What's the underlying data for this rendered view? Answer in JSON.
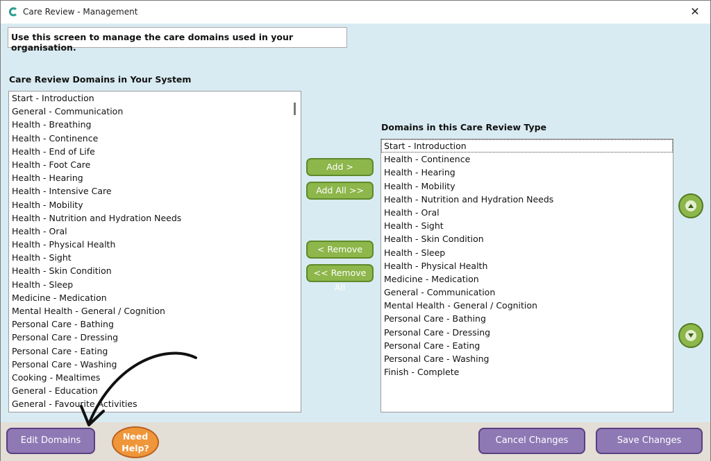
{
  "window": {
    "title": "Care Review - Management",
    "close_symbol": "✕"
  },
  "info_text": "Use this screen to manage the care domains used in your organisation.",
  "left_panel": {
    "label": "Care Review Domains in Your System",
    "items": [
      "Start - Introduction",
      "General - Communication",
      "Health - Breathing",
      "Health - Continence",
      "Health - End of Life",
      "Health - Foot Care",
      "Health - Hearing",
      "Health - Intensive Care",
      "Health - Mobility",
      "Health - Nutrition and Hydration Needs",
      "Health - Oral",
      "Health - Physical Health",
      "Health - Sight",
      "Health - Skin Condition",
      "Health - Sleep",
      "Medicine - Medication",
      "Mental Health - General / Cognition",
      "Personal Care - Bathing",
      "Personal Care - Dressing",
      "Personal Care - Eating",
      "Personal Care - Washing",
      "Cooking - Mealtimes",
      "General - Education",
      "General - Favourite Activities"
    ]
  },
  "right_panel": {
    "label": "Domains in this Care Review Type",
    "items": [
      "Start - Introduction",
      "Health - Continence",
      "Health - Hearing",
      "Health - Mobility",
      "Health - Nutrition and Hydration Needs",
      "Health - Oral",
      "Health - Sight",
      "Health - Skin Condition",
      "Health - Sleep",
      "Health - Physical Health",
      "Medicine - Medication",
      "General - Communication",
      "Mental Health - General / Cognition",
      "Personal Care - Bathing",
      "Personal Care - Dressing",
      "Personal Care - Eating",
      "Personal Care - Washing",
      "Finish - Complete"
    ]
  },
  "transfer_buttons": {
    "add": "Add >",
    "add_all": "Add All >>",
    "remove": "< Remove",
    "remove_all": "<< Remove All"
  },
  "footer": {
    "edit_domains": "Edit Domains",
    "need_help_line1": "Need",
    "need_help_line2": "Help?",
    "cancel_changes": "Cancel Changes",
    "save_changes": "Save Changes"
  },
  "colors": {
    "window_bg": "#d9ebf2",
    "green_button": "#8db64b",
    "purple_button": "#8e79b5",
    "help_orange": "#f0963a",
    "footer_bg": "#e3ded6"
  }
}
